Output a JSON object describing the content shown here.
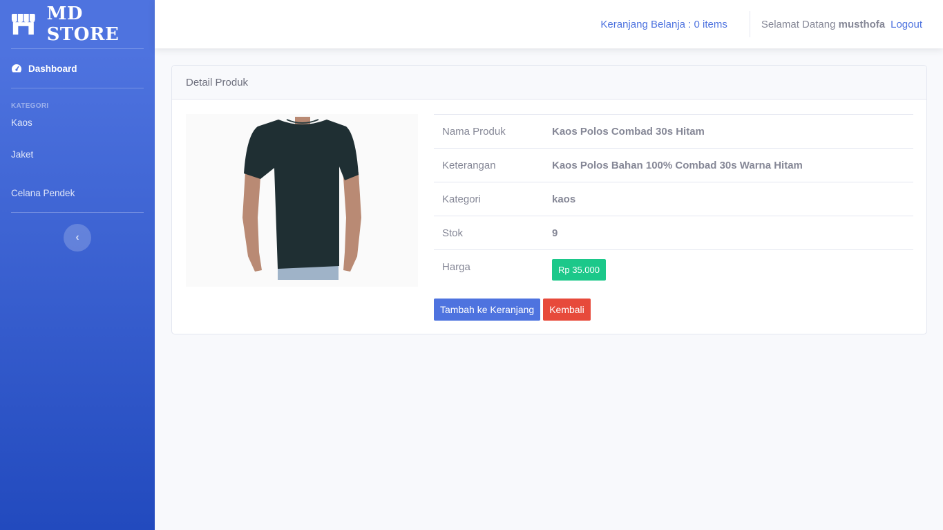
{
  "brand": {
    "name": "MD STORE",
    "icon": "store-icon"
  },
  "sidebar": {
    "dashboard_label": "Dashboard",
    "dashboard_icon": "tachometer-icon",
    "heading": "KATEGORI",
    "items": [
      {
        "label": "Kaos"
      },
      {
        "label": "Jaket"
      },
      {
        "label": "Celana Pendek"
      }
    ],
    "toggle_icon": "chevron-left-icon"
  },
  "topbar": {
    "cart_label": "Keranjang Belanja : 0 items",
    "welcome_prefix": "Selamat Datang",
    "username": "musthofa",
    "logout_label": "Logout"
  },
  "card": {
    "title": "Detail Produk",
    "product_image": "black-tshirt-image",
    "rows": [
      {
        "label": "Nama Produk",
        "value": "Kaos Polos Combad 30s Hitam"
      },
      {
        "label": "Keterangan",
        "value": "Kaos Polos Bahan 100% Combad 30s Warna Hitam"
      },
      {
        "label": "Kategori",
        "value": "kaos"
      },
      {
        "label": "Stok",
        "value": "9"
      }
    ],
    "price_label": "Harga",
    "price_value": "Rp 35.000",
    "add_to_cart_label": "Tambah ke Keranjang",
    "back_label": "Kembali"
  },
  "colors": {
    "primary": "#4e73df",
    "success": "#1cc88a",
    "danger": "#e74a3b",
    "sidebar_gradient_end": "#224abe"
  }
}
